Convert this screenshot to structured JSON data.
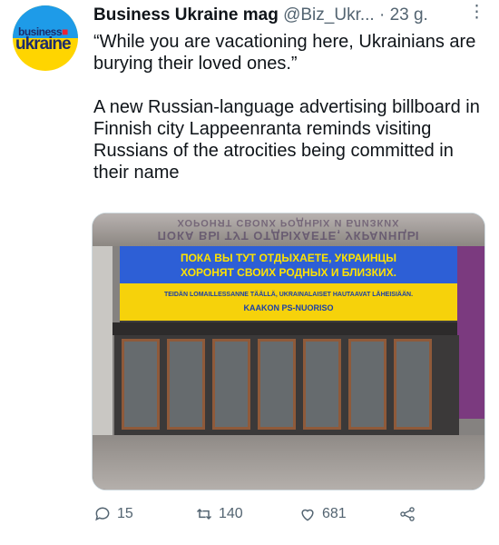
{
  "tweet": {
    "author_name": "Business Ukraine mag",
    "handle": "@Biz_Ukr...",
    "separator": "·",
    "time": "23 g.",
    "more": "⋮",
    "text": "“While you are vacationing here, Ukrainians are burying their loved ones.”\n\nA new Russian-language advertising billboard in Finnish city Lappeenranta reminds visiting Russians of the atrocities being committed in their name"
  },
  "avatar": {
    "line1_a": "business",
    "line1_b": "■",
    "line2": "ukraine"
  },
  "media": {
    "billboard_line1": "ПОКА ВЫ ТУТ ОТДЫХАЕТЕ, УКРАИНЦЫ",
    "billboard_line2": "ХОРОНЯТ СВОИХ РОДНЫХ И БЛИЗКИХ.",
    "billboard_line3": "TEIDÄN LOMAILLESSANNE TÄÄLLÄ, UKRAINALAISET HAUTAAVAT LÄHEISIÄÄN.",
    "billboard_line4": "KAAKON PS-NUORISO",
    "ghost_line1": "ХОРОНЯТ СВОИХ РОДНЫХ И БЛИЗКИХ",
    "ghost_line2": "ПОКА ВЫ ТУТ ОТДЫХАЕТЕ, УКРАИНЦЫ"
  },
  "actions": {
    "reply_count": "15",
    "retweet_count": "140",
    "like_count": "681"
  },
  "colors": {
    "secondary_text": "#536471",
    "billboard_blue": "#2d5fd6",
    "billboard_yellow": "#f6d20b"
  }
}
